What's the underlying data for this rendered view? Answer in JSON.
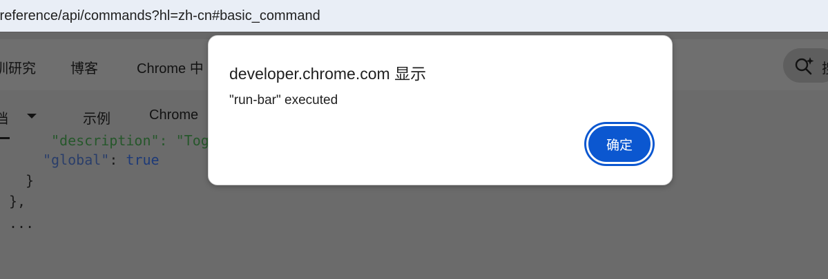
{
  "browser": {
    "url_visible": "/reference/api/commands?hl=zh-cn#basic_command"
  },
  "site_nav": {
    "items": [
      "训研究",
      "博客",
      "Chrome 中"
    ],
    "search_label": "搜"
  },
  "sub_nav": {
    "items": [
      "档",
      "示例",
      "Chrome "
    ]
  },
  "code": {
    "line1": "\"description\": \"Tog",
    "line2_key": "\"global\"",
    "line2_sep": ": ",
    "line2_val": "true",
    "line3": "}",
    "line4": "},",
    "line5": "..."
  },
  "dialog": {
    "title": "developer.chrome.com 显示",
    "message": "\"run-bar\" executed",
    "ok_label": "确定"
  },
  "colors": {
    "accent": "#0b57d0",
    "scrim": "#676767",
    "urlbar": "#e9eef6"
  }
}
